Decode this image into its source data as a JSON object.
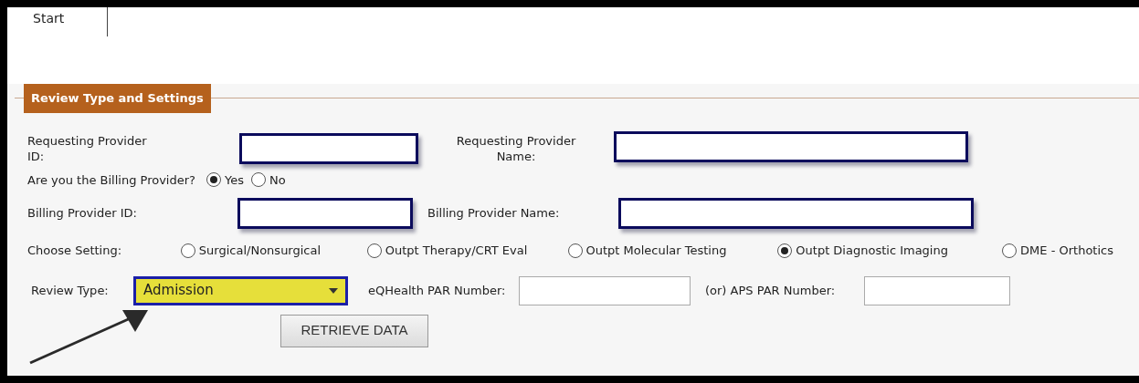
{
  "tab": {
    "label": "Start"
  },
  "section": {
    "title": "Review Type and Settings"
  },
  "requesting_provider_id": {
    "label": "Requesting Provider ID:"
  },
  "requesting_provider_name": {
    "label": "Requesting Provider Name:"
  },
  "billing_question": {
    "label": "Are you the Billing Provider?",
    "options": [
      {
        "label": "Yes",
        "selected": true
      },
      {
        "label": "No",
        "selected": false
      }
    ]
  },
  "billing_provider_id": {
    "label": "Billing Provider ID:"
  },
  "billing_provider_name": {
    "label": "Billing Provider Name:"
  },
  "setting": {
    "label": "Choose Setting:",
    "options": [
      {
        "label": "Surgical/Nonsurgical",
        "selected": false
      },
      {
        "label": "Outpt Therapy/CRT Eval",
        "selected": false
      },
      {
        "label": "Outpt Molecular Testing",
        "selected": false
      },
      {
        "label": "Outpt Diagnostic Imaging",
        "selected": true
      },
      {
        "label": "DME - Orthotics",
        "selected": false
      }
    ]
  },
  "review_type": {
    "label": "Review Type:",
    "value": "Admission"
  },
  "eqhealth_par": {
    "label": "eQHealth PAR Number:"
  },
  "aps_par": {
    "label": "(or) APS PAR Number:"
  },
  "button": {
    "label": "RETRIEVE DATA"
  }
}
